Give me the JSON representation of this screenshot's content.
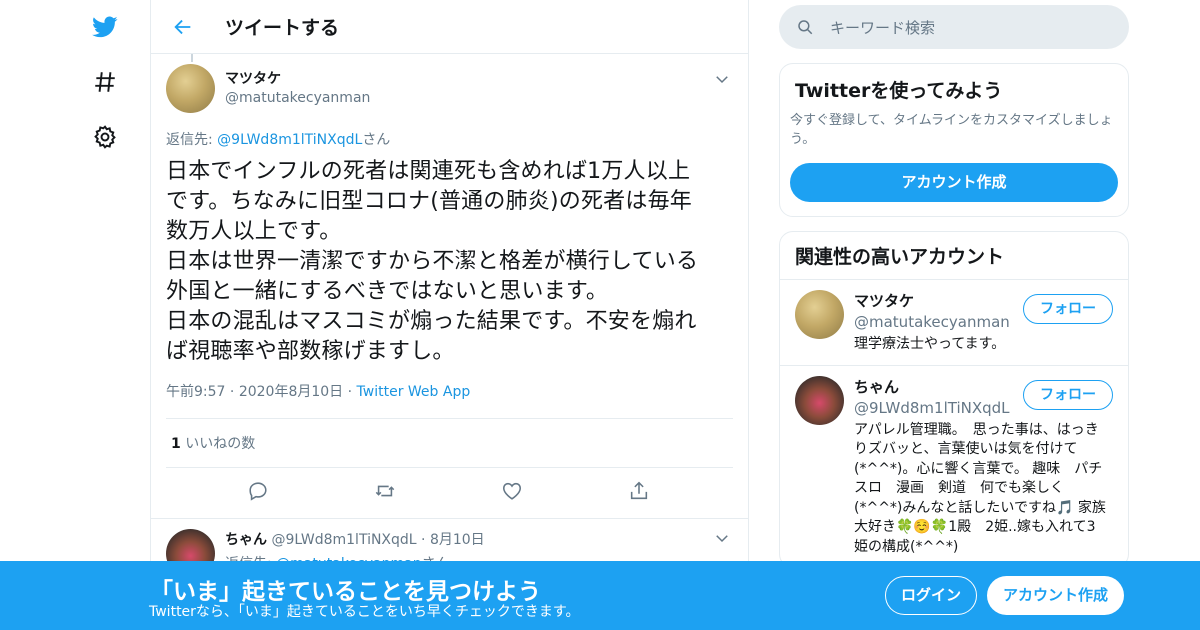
{
  "colors": {
    "brand": "#1da1f2",
    "link": "#1b95e0",
    "muted": "#657786",
    "border": "#e6ecf0"
  },
  "nav": {
    "items": [
      {
        "icon": "twitter-bird-icon"
      },
      {
        "icon": "hashtag-icon"
      },
      {
        "icon": "gear-icon"
      }
    ]
  },
  "header": {
    "title": "ツイートする"
  },
  "tweet": {
    "display_name": "マツタケ",
    "handle": "@matutakecyanman",
    "reply_prefix": "返信先: ",
    "reply_handle": "@9LWd8m1lTiNXqdL",
    "reply_suffix": "さん",
    "text_lines": [
      "日本でインフルの死者は関連死も含めれば1万人以上",
      "です。ちなみに旧型コロナ(普通の肺炎)の死者は毎年",
      "数万人以上です。",
      "日本は世界一清潔ですから不潔と格差が横行している",
      "外国と一緒にするべきではないと思います。",
      "日本の混乱はマスコミが煽った結果です。不安を煽れ",
      "ば視聴率や部数稼げますし。"
    ],
    "time": "午前9:57",
    "dot": "·",
    "date": "2020年8月10日",
    "source": "Twitter Web App",
    "likes_count": "1",
    "likes_label": " いいねの数"
  },
  "reply": {
    "display_name": "ちゃん",
    "handle": "@9LWd8m1lTiNXqdL",
    "dot": "·",
    "date": "8月10日",
    "reply_prefix": "返信先: ",
    "reply_handle": "@matutakecyanman",
    "reply_suffix": "さん"
  },
  "search": {
    "placeholder": "キーワード検索"
  },
  "signup_card": {
    "title": "Twitterを使ってみよう",
    "subtitle": "今すぐ登録して、タイムラインをカスタマイズしましょう。",
    "button": "アカウント作成"
  },
  "related_card": {
    "title": "関連性の高いアカウント",
    "accounts": [
      {
        "display_name": "マツタケ",
        "handle": "@matutakecyanman",
        "bio": "理学療法士やってます。",
        "follow": "フォロー"
      },
      {
        "display_name": "ちゃん",
        "handle": "@9LWd8m1lTiNXqdL",
        "bio": "アパレル管理職。　思った事は、はっきりズバッと、言葉使いは気を付けて(*^^*)。心に響く言葉で。 趣味　パチスロ　漫画　剣道　何でも楽しく(*^^*)みんなと話したいですね🎵 家族大好き🍀☺️🍀1殿　2姫..嫁も入れて3姫の構成(*^^*)",
        "follow": "フォロー"
      }
    ]
  },
  "banner": {
    "title": "「いま」起きていることを見つけよう",
    "subtitle": "Twitterなら、「いま」起きていることをいち早くチェックできます。",
    "login": "ログイン",
    "signup": "アカウント作成"
  }
}
